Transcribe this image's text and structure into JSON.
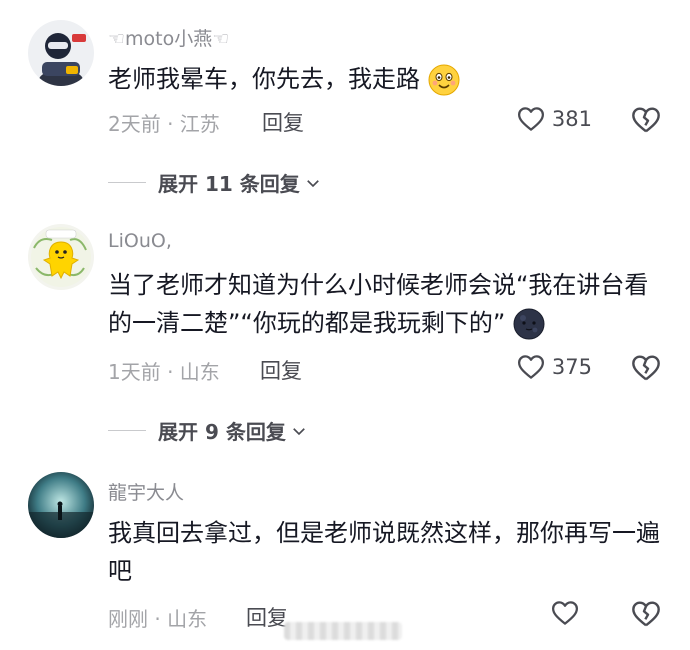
{
  "comments": [
    {
      "username": "moto小燕",
      "text": "老师我晕车，你先去，我走路",
      "time": "2天前 · 江苏",
      "reply_label": "回复",
      "likes": "381",
      "expand_label": "展开 11 条回复"
    },
    {
      "username": "LiOuO,",
      "text": "当了老师才知道为什么小时候老师会说“我在讲台看的一清二楚”“你玩的都是我玩剩下的”",
      "time": "1天前 · 山东",
      "reply_label": "回复",
      "likes": "375",
      "expand_label": "展开 9 条回复"
    },
    {
      "username": "龍宇大人",
      "text": "我真回去拿过，但是老师说既然这样，那你再写一遍吧",
      "time": "刚刚 · 山东",
      "reply_label": "回复",
      "likes": ""
    }
  ],
  "icons": {
    "like": "heart-outline-icon",
    "dislike": "broken-heart-icon",
    "expand": "chevron-down-icon",
    "emoji_smile": "smile-emoji",
    "emoji_dark": "dark-moon-emoji"
  },
  "colors": {
    "text_primary": "#161823",
    "text_secondary": "#8a8b91",
    "action": "#4a4b52"
  }
}
